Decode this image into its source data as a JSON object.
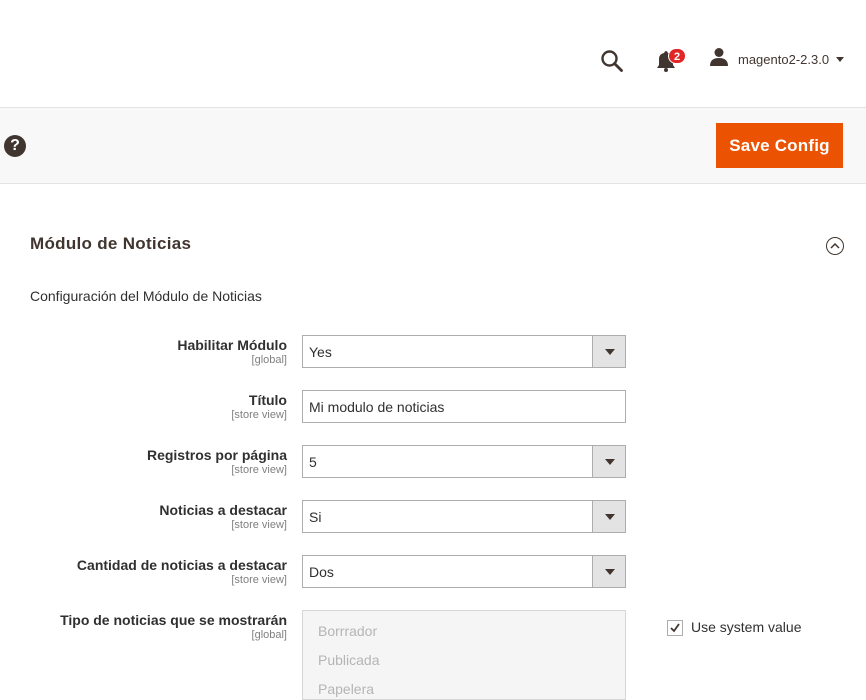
{
  "header": {
    "notifications_count": "2",
    "user_name": "magento2-2.3.0"
  },
  "actions": {
    "help_label": "?",
    "save_label": "Save Config"
  },
  "section": {
    "title": "Módulo de Noticias",
    "description": "Configuración del Módulo de Noticias"
  },
  "fields": [
    {
      "label": "Habilitar Módulo",
      "scope": "[global]",
      "value": "Yes"
    },
    {
      "label": "Título",
      "scope": "[store view]",
      "value": "Mi modulo de noticias"
    },
    {
      "label": "Registros por página",
      "scope": "[store view]",
      "value": "5"
    },
    {
      "label": "Noticias a destacar",
      "scope": "[store view]",
      "value": "Si"
    },
    {
      "label": "Cantidad de noticias a destacar",
      "scope": "[store view]",
      "value": "Dos"
    },
    {
      "label": "Tipo de noticias que se mostrarán",
      "scope": "[global]",
      "options": [
        "Borrrador",
        "Publicada",
        "Papelera"
      ]
    }
  ],
  "use_system_value": {
    "label": "Use system value",
    "checked": true
  },
  "icons": {
    "search": "search-icon",
    "bell": "bell-icon",
    "user": "user-icon",
    "help": "help-icon",
    "collapse": "collapse-icon",
    "check": "checkmark-icon"
  },
  "colors": {
    "accent": "#eb5202",
    "badge": "#e22626",
    "text_dark": "#41362f"
  }
}
